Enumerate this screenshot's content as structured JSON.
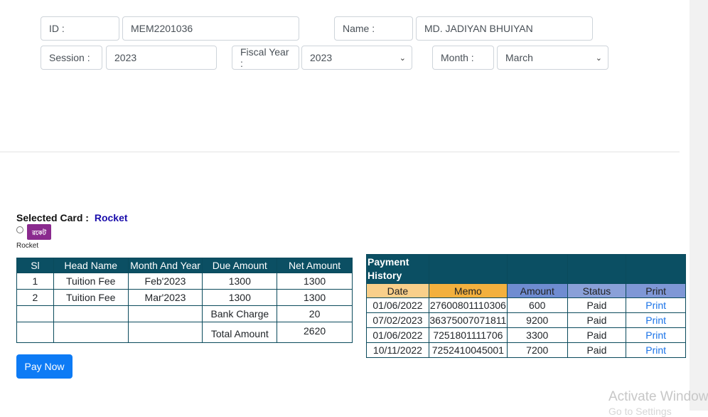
{
  "form": {
    "id_label": "ID :",
    "id_value": "MEM2201036",
    "name_label": "Name :",
    "name_value": "MD. JADIYAN BHUIYAN",
    "session_label": "Session :",
    "session_value": "2023",
    "fiscal_label": "Fiscal Year :",
    "fiscal_value": "2023",
    "month_label": "Month :",
    "month_value": "March"
  },
  "card": {
    "label": "Selected Card :",
    "value": "Rocket",
    "logo_text": "রকেট",
    "option_caption": "Rocket"
  },
  "fee_table": {
    "headers": [
      "Sl",
      "Head Name",
      "Month And Year",
      "Due Amount",
      "Net Amount"
    ],
    "rows": [
      [
        "1",
        "Tuition Fee",
        "Feb'2023",
        "1300",
        "1300"
      ],
      [
        "2",
        "Tuition Fee",
        "Mar'2023",
        "1300",
        "1300"
      ]
    ],
    "bank_charge_label": "Bank Charge",
    "bank_charge_value": "20",
    "total_label": "Total Amount",
    "total_value": "2620"
  },
  "history": {
    "title": "Payment History",
    "headers": [
      "Date",
      "Memo",
      "Amount",
      "Status",
      "Print"
    ],
    "rows": [
      [
        "01/06/2022",
        "27600801110306",
        "600",
        "Paid",
        "Print"
      ],
      [
        "07/02/2023",
        "36375007071811",
        "9200",
        "Paid",
        "Print"
      ],
      [
        "01/06/2022",
        "7251801111706",
        "3300",
        "Paid",
        "Print"
      ],
      [
        "10/11/2022",
        "7252410045001",
        "7200",
        "Paid",
        "Print"
      ]
    ]
  },
  "actions": {
    "pay_now": "Pay Now"
  },
  "watermark": {
    "line1": "Activate Windows",
    "line2": "Go to Settings"
  },
  "colors": {
    "header_bg": "#0b4f63",
    "button": "#0d7bf5",
    "date_col": "#f9cf8a",
    "memo_col": "#f3b03e",
    "amount_col": "#6f8cd1"
  }
}
